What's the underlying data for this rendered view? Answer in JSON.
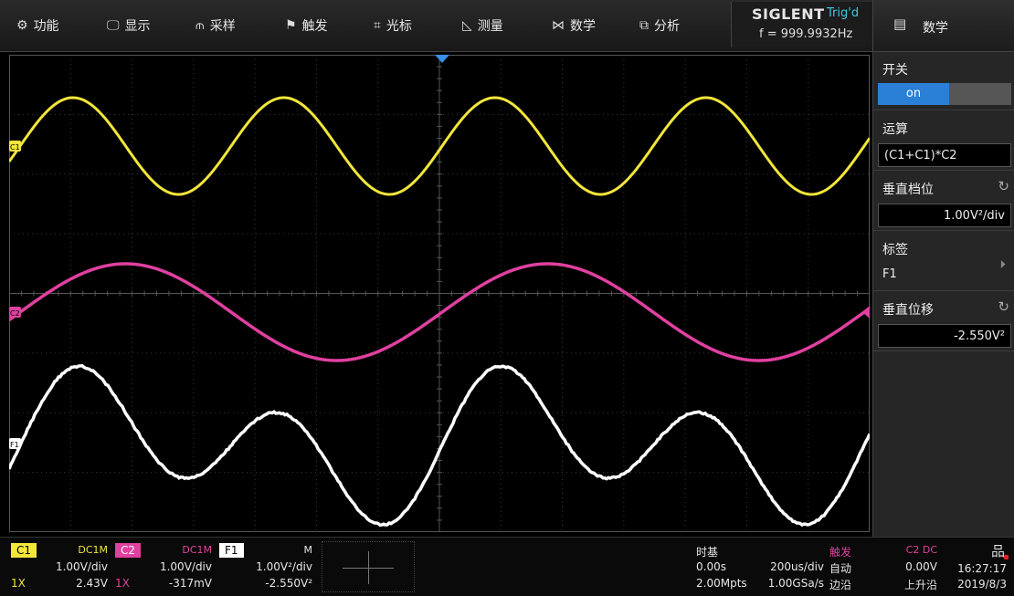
{
  "menu": [
    {
      "icon": "gear-icon",
      "glyph": "⚙",
      "label": "功能"
    },
    {
      "icon": "display-icon",
      "glyph": "🖵",
      "label": "显示"
    },
    {
      "icon": "acquire-icon",
      "glyph": "⫙",
      "label": "采样"
    },
    {
      "icon": "trigger-flag-icon",
      "glyph": "⚑",
      "label": "触发"
    },
    {
      "icon": "cursor-icon",
      "glyph": "⌗",
      "label": "光标"
    },
    {
      "icon": "measure-icon",
      "glyph": "◺",
      "label": "测量"
    },
    {
      "icon": "math-icon",
      "glyph": "⋈",
      "label": "数学"
    },
    {
      "icon": "analysis-icon",
      "glyph": "⧉",
      "label": "分析"
    }
  ],
  "brand": "SIGLENT",
  "trigger_state": "Trig'd",
  "frequency": "f = 999.9932Hz",
  "panel": {
    "title": "数学",
    "switch_label": "开关",
    "switch_value": "on",
    "operation_label": "运算",
    "operation_value": "(C1+C1)*C2",
    "vscale_label": "垂直档位",
    "vscale_value": "1.00V²/div",
    "tag_label": "标签",
    "tag_value": "F1",
    "voffset_label": "垂直位移",
    "voffset_value": "-2.550V²"
  },
  "channel_markers": {
    "c1": "C1",
    "c2": "C2",
    "f1": "F1"
  },
  "bottom": {
    "c1": {
      "name": "C1",
      "coupling": "DC1M",
      "scale": "1.00V/div",
      "probe": "1X",
      "offset": "2.43V"
    },
    "c2": {
      "name": "C2",
      "coupling": "DC1M",
      "scale": "1.00V/div",
      "probe": "1X",
      "offset": "-317mV"
    },
    "f1": {
      "name": "F1",
      "mode": "M",
      "scale": "1.00V²/div",
      "offset": "-2.550V²"
    },
    "timebase": {
      "label": "时基",
      "delay": "0.00s",
      "scale": "200us/div",
      "memory": "2.00Mpts",
      "rate": "1.00GSa/s"
    },
    "trigger": {
      "label": "触发",
      "source": "C2 DC",
      "mode": "自动",
      "level": "0.00V",
      "type": "边沿",
      "slope": "上升沿"
    },
    "clock": {
      "time": "16:27:17",
      "date": "2019/8/3"
    }
  },
  "colors": {
    "c1": "#f2e63a",
    "c2": "#e040a0",
    "f1": "#ffffff",
    "accent": "#2a7fd6",
    "trig": "#41c8e6"
  }
}
